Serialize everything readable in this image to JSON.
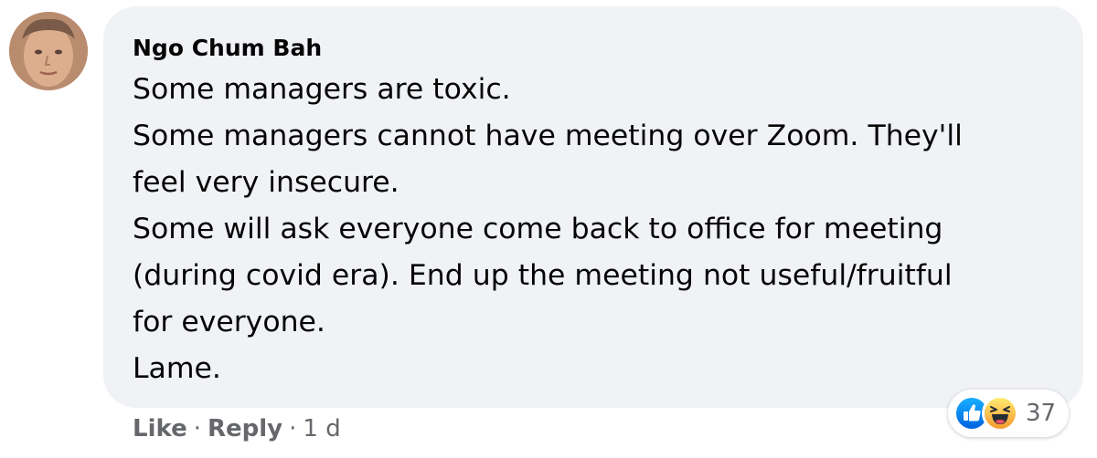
{
  "comment": {
    "author": "Ngo Chum Bah",
    "lines": [
      "Some managers are toxic.",
      "Some managers cannot have meeting over Zoom. They'll",
      "feel very insecure.",
      "Some will ask everyone come back to office for meeting",
      "(during covid era). End up the meeting not useful/fruitful",
      "for everyone.",
      "Lame."
    ],
    "reactions": {
      "icons": [
        "like-icon",
        "haha-icon"
      ],
      "count": "37"
    },
    "actions": {
      "like": "Like",
      "reply": "Reply",
      "separator": "·",
      "time": "1 d"
    }
  },
  "colors": {
    "bubble": "#f0f2f5",
    "text": "#050505",
    "secondary": "#65676b",
    "like_blue": "#1877f2",
    "haha_yellow": "#f7b928"
  }
}
